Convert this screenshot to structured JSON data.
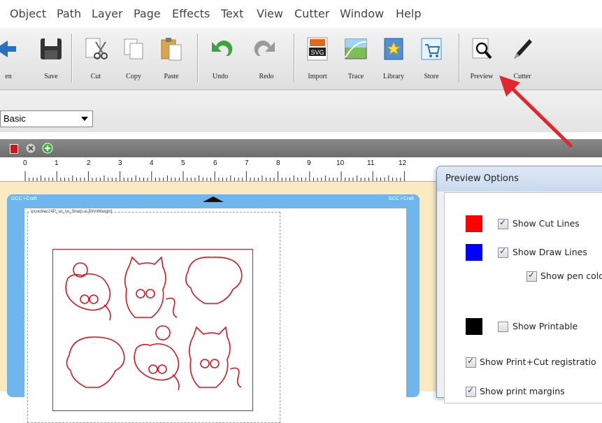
{
  "menu": [
    "Object",
    "Path",
    "Layer",
    "Page",
    "Effects",
    "Text",
    "View",
    "Cutter",
    "Window",
    "Help"
  ],
  "toolbar": {
    "open": "en",
    "save": "Save",
    "cut": "Cut",
    "copy": "Copy",
    "paste": "Paste",
    "undo": "Undo",
    "redo": "Redo",
    "import": "Import",
    "trace": "Trace",
    "library": "Library",
    "store": "Store",
    "preview": "Preview",
    "cutter": "Cutter",
    "import_badge": "SVG"
  },
  "style_combo": {
    "value": "Basic"
  },
  "ruler": {
    "numbers": [
      "0",
      "1",
      "2",
      "3",
      "4",
      "5",
      "6",
      "7",
      "8",
      "9",
      "10",
      "11",
      "12"
    ]
  },
  "mat": {
    "corner_label_left": "GCC i-Craft",
    "corner_label_right": "GCC i-Craft",
    "page_caption": "ipconNec24P_so_so_Sharp.ai [PrintMargin]"
  },
  "dialog": {
    "title": "Preview Options",
    "options": [
      {
        "label": "Show Cut Lines",
        "checked": true,
        "swatch": "#ff0000"
      },
      {
        "label": "Show Draw Lines",
        "checked": true,
        "swatch": "#0000ff"
      },
      {
        "label": "Show pen colo",
        "checked": true,
        "swatch": ""
      },
      {
        "label": "Show Printable",
        "checked": false,
        "swatch": "#000000"
      },
      {
        "label": "Show Print+Cut registratio",
        "checked": true,
        "swatch": ""
      },
      {
        "label": "Show print margins",
        "checked": true,
        "swatch": ""
      }
    ]
  },
  "colors": {
    "cut_line": "#e0141e",
    "mat_blue": "#6fb6ec",
    "canvas_bg": "#fbe9c2",
    "arrow": "#e0272d"
  }
}
